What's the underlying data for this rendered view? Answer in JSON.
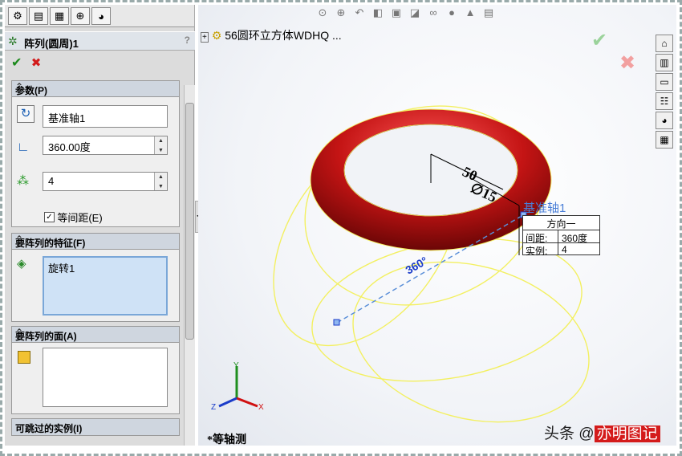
{
  "panel": {
    "title": "阵列(圆周)1",
    "help": "?",
    "ok": "✔",
    "cancel": "✖",
    "groups": {
      "params": {
        "label": "参数(P)",
        "chevron": "⌃"
      },
      "features": {
        "label": "要阵列的特征(F)",
        "chevron": "⌃"
      },
      "faces": {
        "label": "要阵列的面(A)",
        "chevron": "⌃"
      },
      "skip": {
        "label": "可跳过的实例(I)",
        "chevron": "⌄"
      }
    },
    "axis_value": "基准轴1",
    "angle_value": "360.00度",
    "count_value": "4",
    "equal_spacing": "等间距(E)",
    "feature_item": "旋转1"
  },
  "tree": {
    "item": "56圆环立方体WDHQ ..."
  },
  "model": {
    "dim1": "50",
    "dim2": "∅15",
    "angle_label": "360°",
    "axis_label": "基准轴1"
  },
  "callout": {
    "header": "方向一",
    "spacing_key": "间距:",
    "spacing_val": "360度",
    "count_key": "实例:",
    "count_val": "4"
  },
  "view_name": "*等轴测",
  "watermark": {
    "prefix": "头条 @",
    "name": "亦明图记"
  },
  "colors": {
    "torus": "#c41414",
    "ring": "#f3f061",
    "accent": "#1a3cc9"
  }
}
